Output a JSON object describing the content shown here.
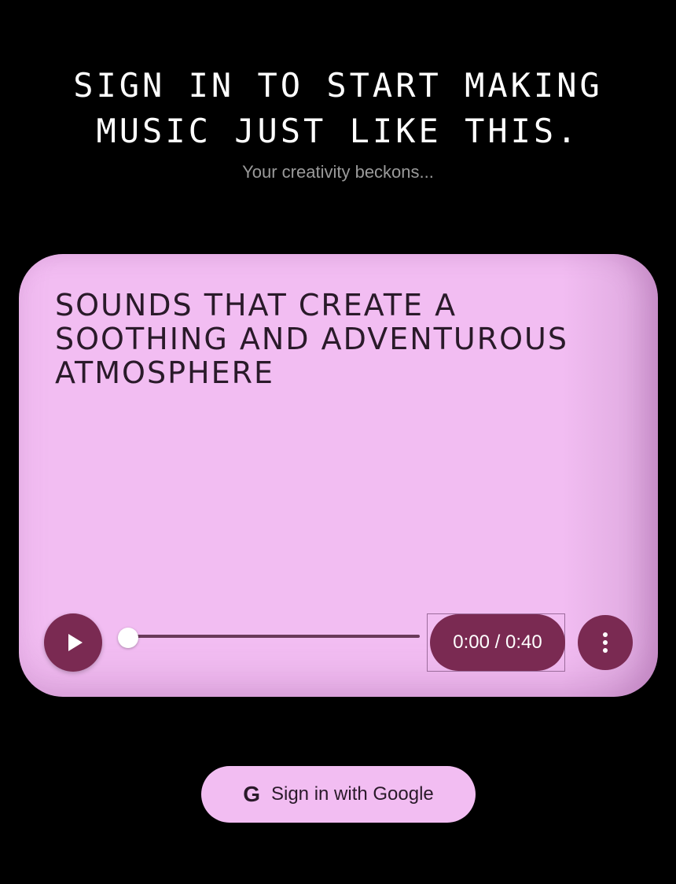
{
  "header": {
    "title_line_1": "SIGN IN TO START MAKING",
    "title_line_2": "MUSIC JUST LIKE THIS.",
    "subtitle": "Your creativity beckons..."
  },
  "card": {
    "title": "SOUNDS THAT CREATE A SOOTHING AND ADVENTUROUS ATMOSPHERE",
    "player": {
      "play_icon": "play-icon",
      "time_display": "0:00 / 0:40",
      "progress": 0,
      "menu_icon": "more-vert-icon"
    }
  },
  "sign_in": {
    "icon": "google-g-icon",
    "icon_glyph": "G",
    "label": "Sign in with Google"
  },
  "colors": {
    "background": "#000000",
    "card": "#f2bdf2",
    "accent": "#7a2a52",
    "subtitle": "#9a9a9a"
  }
}
